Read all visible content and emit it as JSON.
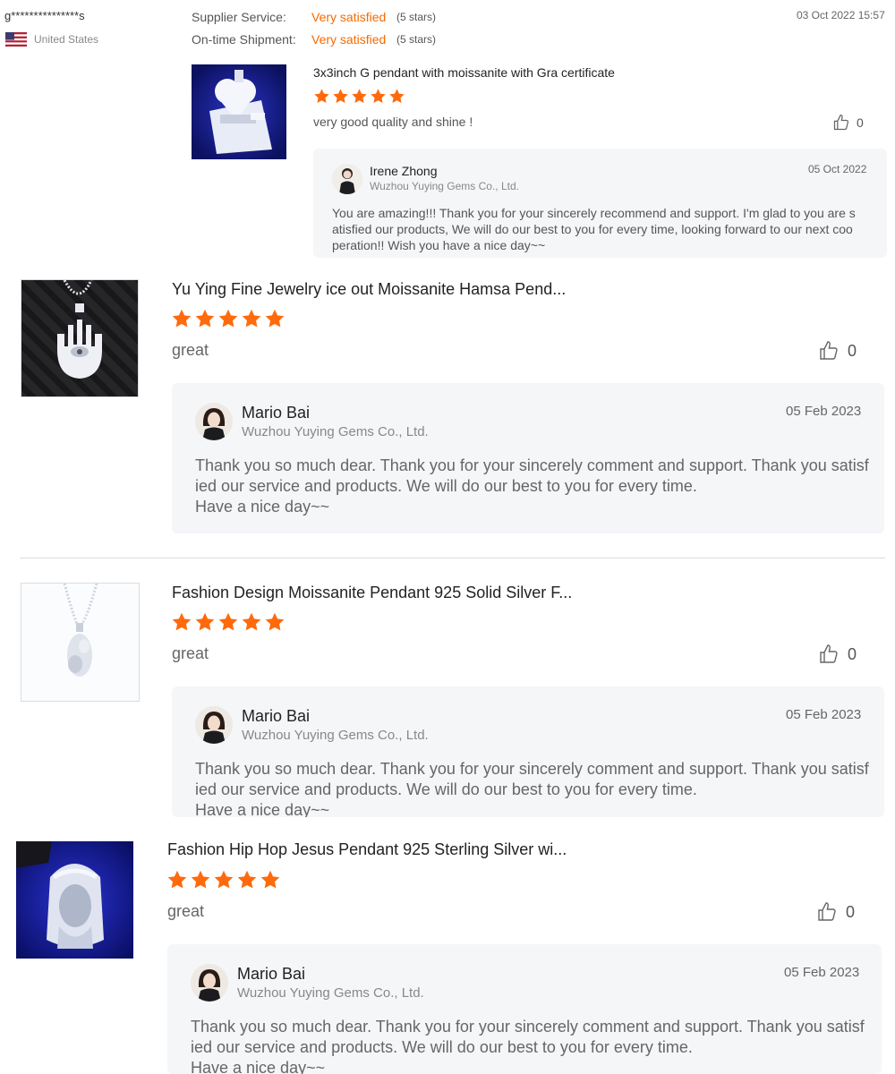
{
  "colors": {
    "accent": "#f56a00",
    "star": "#ff6a0d",
    "reply_bg": "#f5f6f8"
  },
  "icons": {
    "like": "thumbs-up-icon",
    "star": "star-icon",
    "flag": "us-flag-icon"
  },
  "review1": {
    "user": "g***************s",
    "country": "United States",
    "supplier_service_label": "Supplier Service:",
    "supplier_service_value": "Very satisfied",
    "supplier_service_stars": "(5 stars)",
    "shipment_label": "On-time Shipment:",
    "shipment_value": "Very satisfied",
    "shipment_stars": "(5 stars)",
    "date": "03 Oct 2022 15:57",
    "product_title": "3x3inch G pendant with moissanite with Gra certificate",
    "rating": 5,
    "comment": "very good quality and shine !",
    "likes": "0",
    "reply": {
      "name": "Irene Zhong",
      "company": "Wuzhou Yuying Gems Co., Ltd.",
      "date": "05 Oct 2022",
      "line1": "You are amazing!!! Thank you for your sincerely recommend and support. I'm glad to you are s",
      "line2": "atisfied our products, We will do our best to you for every time, looking forward to our next coo",
      "line3": "peration!! Wish you have a nice day~~"
    }
  },
  "review2": {
    "product_title": "Yu Ying Fine Jewelry ice out Moissanite Hamsa Pend...",
    "rating": 5,
    "comment": "great",
    "likes": "0",
    "reply": {
      "name": "Mario Bai",
      "company": "Wuzhou Yuying Gems Co., Ltd.",
      "date": "05 Feb 2023",
      "line1": "Thank you so much dear. Thank you for your sincerely comment and support. Thank you satisf",
      "line2": "ied our  service and products. We will do our best to you for every time.",
      "line3": "Have a  nice day~~"
    }
  },
  "review3": {
    "product_title": "Fashion Design Moissanite Pendant 925 Solid Silver F...",
    "rating": 5,
    "comment": "great",
    "likes": "0",
    "reply": {
      "name": "Mario Bai",
      "company": "Wuzhou Yuying Gems Co., Ltd.",
      "date": "05 Feb 2023",
      "line1": "Thank you so much dear. Thank you for your sincerely comment and support. Thank you satisf",
      "line2": "ied our  service and products. We will do our best to you for every time.",
      "line3": "Have a  nice day~~"
    }
  },
  "review4": {
    "product_title": "Fashion Hip Hop Jesus Pendant 925 Sterling Silver wi...",
    "rating": 5,
    "comment": "great",
    "likes": "0",
    "reply": {
      "name": "Mario Bai",
      "company": "Wuzhou Yuying Gems Co., Ltd.",
      "date": "05 Feb 2023",
      "line1": "Thank you so much dear. Thank you for your sincerely comment and support. Thank you satisf",
      "line2": "ied our  service and products. We will do our best to you for every time.",
      "line3": "Have a  nice day~~"
    }
  }
}
